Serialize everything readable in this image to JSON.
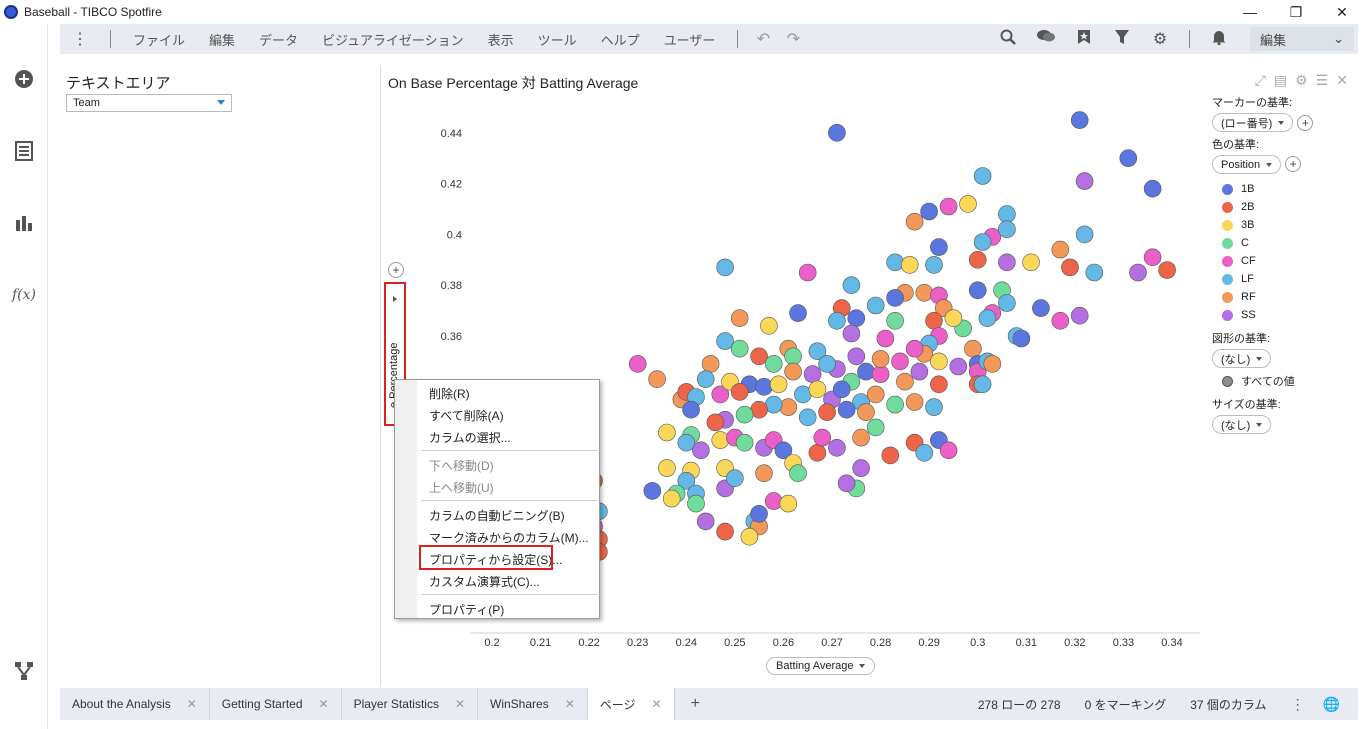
{
  "window": {
    "title": "Baseball - TIBCO Spotfire"
  },
  "menu": {
    "items": [
      "ファイル",
      "編集",
      "データ",
      "ビジュアライゼーション",
      "表示",
      "ツール",
      "ヘルプ",
      "ユーザー"
    ],
    "edit_mode": "編集"
  },
  "left_panel": {
    "title": "テキストエリア",
    "filter_value": "Team"
  },
  "viz": {
    "title": "On Base Percentage 対 Batting Average",
    "x_axis_label": "Batting Average",
    "y_axis_label": "e Percentage"
  },
  "legend": {
    "marker_label": "マーカーの基準:",
    "marker_value": "(ロー番号)",
    "color_label": "色の基準:",
    "color_value": "Position",
    "shape_label": "図形の基準:",
    "shape_value": "(なし)",
    "all_values": "すべての値",
    "size_label": "サイズの基準:",
    "size_value": "(なし)"
  },
  "context_menu": {
    "items": [
      "削除(R)",
      "すべて削除(A)",
      "カラムの選択...",
      "下へ移動(D)",
      "上へ移動(U)",
      "カラムの自動ビニング(B)",
      "マーク済みからのカラム(M)...",
      "プロパティから設定(S)...",
      "カスタム演算式(C)...",
      "プロパティ(P)"
    ],
    "disabled": [
      3,
      4
    ]
  },
  "tabs": [
    "About the Analysis",
    "Getting Started",
    "Player Statistics",
    "WinShares",
    "ページ"
  ],
  "status": {
    "rows": "278 ローの 278",
    "marked": "0 をマーキング",
    "columns": "37 個のカラム"
  },
  "colors": {
    "1B": "#5b76df",
    "2B": "#ee6448",
    "3B": "#fbd757",
    "C": "#6fdc9c",
    "CF": "#ea60c8",
    "LF": "#63b8e6",
    "RF": "#f39858",
    "SS": "#b46fe0"
  },
  "chart_data": {
    "type": "scatter",
    "xlabel": "Batting Average",
    "ylabel": "On Base Percentage",
    "xlim": [
      0.2,
      0.34
    ],
    "ylim": [
      0.29,
      0.45
    ],
    "x_ticks": [
      "0.2",
      "0.21",
      "0.22",
      "0.23",
      "0.24",
      "0.25",
      "0.26",
      "0.27",
      "0.28",
      "0.29",
      "0.3",
      "0.31",
      "0.32",
      "0.33",
      "0.34"
    ],
    "y_ticks": [
      "0.44",
      "0.42",
      "0.4",
      "0.38",
      "0.36"
    ],
    "legend": [
      "1B",
      "2B",
      "3B",
      "C",
      "CF",
      "LF",
      "RF",
      "SS"
    ],
    "points": [
      {
        "x": 0.271,
        "y": 0.44,
        "s": "1B"
      },
      {
        "x": 0.321,
        "y": 0.445,
        "s": "1B"
      },
      {
        "x": 0.331,
        "y": 0.43,
        "s": "1B"
      },
      {
        "x": 0.336,
        "y": 0.418,
        "s": "1B"
      },
      {
        "x": 0.322,
        "y": 0.421,
        "s": "SS"
      },
      {
        "x": 0.301,
        "y": 0.423,
        "s": "LF"
      },
      {
        "x": 0.294,
        "y": 0.411,
        "s": "CF"
      },
      {
        "x": 0.298,
        "y": 0.412,
        "s": "3B"
      },
      {
        "x": 0.29,
        "y": 0.409,
        "s": "1B"
      },
      {
        "x": 0.287,
        "y": 0.405,
        "s": "RF"
      },
      {
        "x": 0.306,
        "y": 0.408,
        "s": "LF"
      },
      {
        "x": 0.303,
        "y": 0.399,
        "s": "CF"
      },
      {
        "x": 0.306,
        "y": 0.402,
        "s": "LF"
      },
      {
        "x": 0.322,
        "y": 0.4,
        "s": "LF"
      },
      {
        "x": 0.292,
        "y": 0.395,
        "s": "1B"
      },
      {
        "x": 0.301,
        "y": 0.397,
        "s": "LF"
      },
      {
        "x": 0.317,
        "y": 0.394,
        "s": "RF"
      },
      {
        "x": 0.3,
        "y": 0.39,
        "s": "2B"
      },
      {
        "x": 0.283,
        "y": 0.389,
        "s": "LF"
      },
      {
        "x": 0.286,
        "y": 0.388,
        "s": "3B"
      },
      {
        "x": 0.291,
        "y": 0.388,
        "s": "LF"
      },
      {
        "x": 0.306,
        "y": 0.389,
        "s": "SS"
      },
      {
        "x": 0.311,
        "y": 0.389,
        "s": "3B"
      },
      {
        "x": 0.319,
        "y": 0.387,
        "s": "2B"
      },
      {
        "x": 0.324,
        "y": 0.385,
        "s": "LF"
      },
      {
        "x": 0.333,
        "y": 0.385,
        "s": "SS"
      },
      {
        "x": 0.336,
        "y": 0.391,
        "s": "CF"
      },
      {
        "x": 0.339,
        "y": 0.386,
        "s": "2B"
      },
      {
        "x": 0.248,
        "y": 0.387,
        "s": "LF"
      },
      {
        "x": 0.265,
        "y": 0.385,
        "s": "CF"
      },
      {
        "x": 0.274,
        "y": 0.38,
        "s": "LF"
      },
      {
        "x": 0.285,
        "y": 0.377,
        "s": "RF"
      },
      {
        "x": 0.289,
        "y": 0.377,
        "s": "RF"
      },
      {
        "x": 0.283,
        "y": 0.375,
        "s": "1B"
      },
      {
        "x": 0.292,
        "y": 0.376,
        "s": "CF"
      },
      {
        "x": 0.3,
        "y": 0.378,
        "s": "1B"
      },
      {
        "x": 0.305,
        "y": 0.378,
        "s": "C"
      },
      {
        "x": 0.306,
        "y": 0.373,
        "s": "LF"
      },
      {
        "x": 0.313,
        "y": 0.371,
        "s": "1B"
      },
      {
        "x": 0.303,
        "y": 0.369,
        "s": "CF"
      },
      {
        "x": 0.302,
        "y": 0.367,
        "s": "LF"
      },
      {
        "x": 0.297,
        "y": 0.363,
        "s": "C"
      },
      {
        "x": 0.308,
        "y": 0.36,
        "s": "LF"
      },
      {
        "x": 0.309,
        "y": 0.359,
        "s": "1B"
      },
      {
        "x": 0.299,
        "y": 0.355,
        "s": "RF"
      },
      {
        "x": 0.317,
        "y": 0.366,
        "s": "CF"
      },
      {
        "x": 0.321,
        "y": 0.368,
        "s": "SS"
      },
      {
        "x": 0.293,
        "y": 0.371,
        "s": "RF"
      },
      {
        "x": 0.295,
        "y": 0.367,
        "s": "3B"
      },
      {
        "x": 0.291,
        "y": 0.366,
        "s": "2B"
      },
      {
        "x": 0.292,
        "y": 0.36,
        "s": "CF"
      },
      {
        "x": 0.29,
        "y": 0.357,
        "s": "LF"
      },
      {
        "x": 0.289,
        "y": 0.353,
        "s": "RF"
      },
      {
        "x": 0.287,
        "y": 0.355,
        "s": "CF"
      },
      {
        "x": 0.281,
        "y": 0.359,
        "s": "CF"
      },
      {
        "x": 0.279,
        "y": 0.372,
        "s": "LF"
      },
      {
        "x": 0.283,
        "y": 0.366,
        "s": "C"
      },
      {
        "x": 0.272,
        "y": 0.371,
        "s": "2B"
      },
      {
        "x": 0.271,
        "y": 0.366,
        "s": "LF"
      },
      {
        "x": 0.275,
        "y": 0.367,
        "s": "1B"
      },
      {
        "x": 0.263,
        "y": 0.369,
        "s": "1B"
      },
      {
        "x": 0.257,
        "y": 0.364,
        "s": "3B"
      },
      {
        "x": 0.274,
        "y": 0.361,
        "s": "SS"
      },
      {
        "x": 0.267,
        "y": 0.354,
        "s": "LF"
      },
      {
        "x": 0.261,
        "y": 0.355,
        "s": "RF"
      },
      {
        "x": 0.262,
        "y": 0.352,
        "s": "C"
      },
      {
        "x": 0.255,
        "y": 0.352,
        "s": "2B"
      },
      {
        "x": 0.251,
        "y": 0.367,
        "s": "RF"
      },
      {
        "x": 0.248,
        "y": 0.358,
        "s": "LF"
      },
      {
        "x": 0.251,
        "y": 0.355,
        "s": "C"
      },
      {
        "x": 0.245,
        "y": 0.349,
        "s": "RF"
      },
      {
        "x": 0.244,
        "y": 0.343,
        "s": "LF"
      },
      {
        "x": 0.23,
        "y": 0.349,
        "s": "CF"
      },
      {
        "x": 0.234,
        "y": 0.343,
        "s": "RF"
      },
      {
        "x": 0.239,
        "y": 0.335,
        "s": "RF"
      },
      {
        "x": 0.24,
        "y": 0.338,
        "s": "2B"
      },
      {
        "x": 0.242,
        "y": 0.336,
        "s": "LF"
      },
      {
        "x": 0.241,
        "y": 0.331,
        "s": "1B"
      },
      {
        "x": 0.247,
        "y": 0.337,
        "s": "CF"
      },
      {
        "x": 0.249,
        "y": 0.342,
        "s": "3B"
      },
      {
        "x": 0.253,
        "y": 0.341,
        "s": "1B"
      },
      {
        "x": 0.251,
        "y": 0.338,
        "s": "2B"
      },
      {
        "x": 0.256,
        "y": 0.34,
        "s": "1B"
      },
      {
        "x": 0.259,
        "y": 0.341,
        "s": "3B"
      },
      {
        "x": 0.262,
        "y": 0.346,
        "s": "RF"
      },
      {
        "x": 0.266,
        "y": 0.345,
        "s": "SS"
      },
      {
        "x": 0.271,
        "y": 0.347,
        "s": "SS"
      },
      {
        "x": 0.274,
        "y": 0.342,
        "s": "C"
      },
      {
        "x": 0.277,
        "y": 0.346,
        "s": "1B"
      },
      {
        "x": 0.28,
        "y": 0.345,
        "s": "CF"
      },
      {
        "x": 0.285,
        "y": 0.342,
        "s": "RF"
      },
      {
        "x": 0.288,
        "y": 0.346,
        "s": "SS"
      },
      {
        "x": 0.292,
        "y": 0.341,
        "s": "2B"
      },
      {
        "x": 0.296,
        "y": 0.348,
        "s": "SS"
      },
      {
        "x": 0.3,
        "y": 0.349,
        "s": "1B"
      },
      {
        "x": 0.3,
        "y": 0.346,
        "s": "CF"
      },
      {
        "x": 0.302,
        "y": 0.35,
        "s": "LF"
      },
      {
        "x": 0.303,
        "y": 0.349,
        "s": "RF"
      },
      {
        "x": 0.292,
        "y": 0.35,
        "s": "3B"
      },
      {
        "x": 0.284,
        "y": 0.35,
        "s": "CF"
      },
      {
        "x": 0.28,
        "y": 0.351,
        "s": "RF"
      },
      {
        "x": 0.275,
        "y": 0.352,
        "s": "SS"
      },
      {
        "x": 0.269,
        "y": 0.349,
        "s": "LF"
      },
      {
        "x": 0.258,
        "y": 0.349,
        "s": "C"
      },
      {
        "x": 0.264,
        "y": 0.337,
        "s": "LF"
      },
      {
        "x": 0.267,
        "y": 0.339,
        "s": "3B"
      },
      {
        "x": 0.27,
        "y": 0.335,
        "s": "SS"
      },
      {
        "x": 0.272,
        "y": 0.339,
        "s": "1B"
      },
      {
        "x": 0.276,
        "y": 0.334,
        "s": "LF"
      },
      {
        "x": 0.279,
        "y": 0.337,
        "s": "RF"
      },
      {
        "x": 0.283,
        "y": 0.333,
        "s": "C"
      },
      {
        "x": 0.287,
        "y": 0.334,
        "s": "RF"
      },
      {
        "x": 0.291,
        "y": 0.332,
        "s": "LF"
      },
      {
        "x": 0.3,
        "y": 0.341,
        "s": "2B"
      },
      {
        "x": 0.301,
        "y": 0.341,
        "s": "LF"
      },
      {
        "x": 0.277,
        "y": 0.33,
        "s": "RF"
      },
      {
        "x": 0.273,
        "y": 0.331,
        "s": "1B"
      },
      {
        "x": 0.269,
        "y": 0.33,
        "s": "2B"
      },
      {
        "x": 0.265,
        "y": 0.328,
        "s": "LF"
      },
      {
        "x": 0.261,
        "y": 0.332,
        "s": "RF"
      },
      {
        "x": 0.258,
        "y": 0.333,
        "s": "LF"
      },
      {
        "x": 0.255,
        "y": 0.331,
        "s": "2B"
      },
      {
        "x": 0.252,
        "y": 0.329,
        "s": "C"
      },
      {
        "x": 0.248,
        "y": 0.327,
        "s": "SS"
      },
      {
        "x": 0.246,
        "y": 0.326,
        "s": "2B"
      },
      {
        "x": 0.241,
        "y": 0.321,
        "s": "C"
      },
      {
        "x": 0.236,
        "y": 0.322,
        "s": "3B"
      },
      {
        "x": 0.24,
        "y": 0.318,
        "s": "LF"
      },
      {
        "x": 0.243,
        "y": 0.315,
        "s": "SS"
      },
      {
        "x": 0.247,
        "y": 0.319,
        "s": "3B"
      },
      {
        "x": 0.25,
        "y": 0.32,
        "s": "CF"
      },
      {
        "x": 0.252,
        "y": 0.318,
        "s": "C"
      },
      {
        "x": 0.256,
        "y": 0.316,
        "s": "SS"
      },
      {
        "x": 0.258,
        "y": 0.319,
        "s": "CF"
      },
      {
        "x": 0.26,
        "y": 0.315,
        "s": "1B"
      },
      {
        "x": 0.262,
        "y": 0.31,
        "s": "3B"
      },
      {
        "x": 0.267,
        "y": 0.314,
        "s": "2B"
      },
      {
        "x": 0.268,
        "y": 0.32,
        "s": "CF"
      },
      {
        "x": 0.271,
        "y": 0.316,
        "s": "SS"
      },
      {
        "x": 0.276,
        "y": 0.32,
        "s": "RF"
      },
      {
        "x": 0.279,
        "y": 0.324,
        "s": "C"
      },
      {
        "x": 0.287,
        "y": 0.318,
        "s": "2B"
      },
      {
        "x": 0.289,
        "y": 0.314,
        "s": "LF"
      },
      {
        "x": 0.292,
        "y": 0.319,
        "s": "1B"
      },
      {
        "x": 0.294,
        "y": 0.315,
        "s": "CF"
      },
      {
        "x": 0.282,
        "y": 0.313,
        "s": "2B"
      },
      {
        "x": 0.276,
        "y": 0.308,
        "s": "SS"
      },
      {
        "x": 0.275,
        "y": 0.3,
        "s": "C"
      },
      {
        "x": 0.273,
        "y": 0.302,
        "s": "SS"
      },
      {
        "x": 0.263,
        "y": 0.306,
        "s": "C"
      },
      {
        "x": 0.256,
        "y": 0.306,
        "s": "RF"
      },
      {
        "x": 0.248,
        "y": 0.308,
        "s": "3B"
      },
      {
        "x": 0.248,
        "y": 0.3,
        "s": "SS"
      },
      {
        "x": 0.25,
        "y": 0.304,
        "s": "LF"
      },
      {
        "x": 0.241,
        "y": 0.307,
        "s": "3B"
      },
      {
        "x": 0.236,
        "y": 0.308,
        "s": "3B"
      },
      {
        "x": 0.24,
        "y": 0.303,
        "s": "LF"
      },
      {
        "x": 0.238,
        "y": 0.298,
        "s": "C"
      },
      {
        "x": 0.242,
        "y": 0.298,
        "s": "LF"
      },
      {
        "x": 0.233,
        "y": 0.299,
        "s": "1B"
      },
      {
        "x": 0.237,
        "y": 0.296,
        "s": "3B"
      },
      {
        "x": 0.242,
        "y": 0.294,
        "s": "C"
      },
      {
        "x": 0.244,
        "y": 0.287,
        "s": "SS"
      },
      {
        "x": 0.254,
        "y": 0.287,
        "s": "LF"
      },
      {
        "x": 0.255,
        "y": 0.285,
        "s": "RF"
      },
      {
        "x": 0.253,
        "y": 0.281,
        "s": "3B"
      },
      {
        "x": 0.248,
        "y": 0.283,
        "s": "2B"
      },
      {
        "x": 0.222,
        "y": 0.28,
        "s": "2B"
      },
      {
        "x": 0.221,
        "y": 0.303,
        "s": "2B"
      },
      {
        "x": 0.222,
        "y": 0.291,
        "s": "LF"
      },
      {
        "x": 0.221,
        "y": 0.285,
        "s": "CF"
      },
      {
        "x": 0.222,
        "y": 0.275,
        "s": "2B"
      },
      {
        "x": 0.255,
        "y": 0.29,
        "s": "1B"
      },
      {
        "x": 0.258,
        "y": 0.295,
        "s": "CF"
      },
      {
        "x": 0.261,
        "y": 0.294,
        "s": "3B"
      }
    ]
  }
}
